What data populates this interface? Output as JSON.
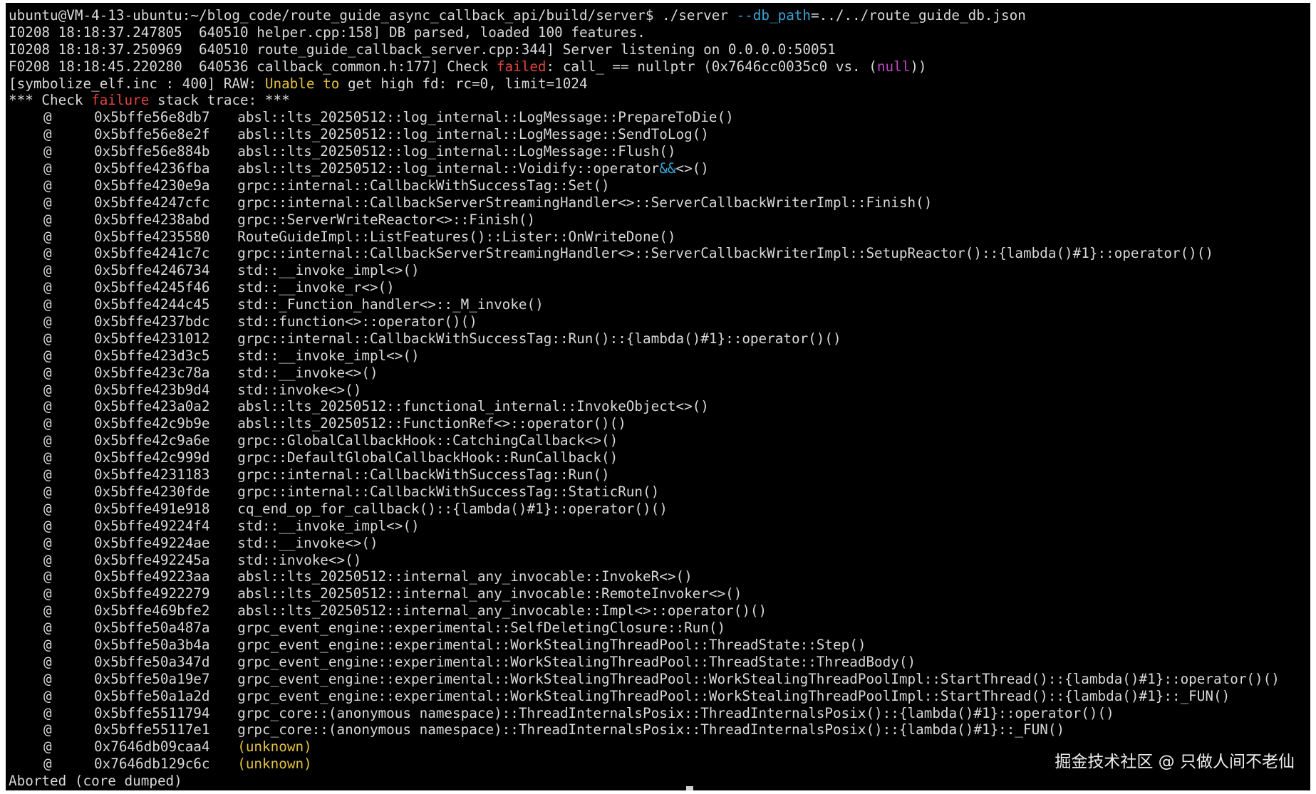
{
  "terminal": {
    "prompt": "ubuntu@VM-4-13-ubuntu:~/blog_code/route_guide_async_callback_api/build/server$ ",
    "command": "./server",
    "flag": "--db_path",
    "flag_value": "=../../route_guide_db.json",
    "log_lines": [
      "I0208 18:18:37.247805  640510 helper.cpp:158] DB parsed, loaded 100 features.",
      "I0208 18:18:37.250969  640510 route_guide_callback_server.cpp:344] Server listening on 0.0.0.0:50051"
    ],
    "fatal": {
      "prefix": "F0208 18:18:45.220280  640536 callback_common.h:177] Check ",
      "failed_word": "failed",
      "middle": ": call_ == nullptr (0x7646cc0035c0 vs. (",
      "null_word": "null",
      "suffix": "))"
    },
    "symbolize": {
      "prefix": "[symbolize_elf.inc : 400] RAW: ",
      "unable": "Unable to",
      "suffix": " get high fd: rc=0, limit=1024"
    },
    "trace_header": {
      "prefix": "*** Check ",
      "failure_word": "failure",
      "suffix": " stack trace: ***"
    },
    "frames": [
      {
        "at": "@",
        "addr": "0x5bffe56e8db7",
        "fn": "absl::lts_20250512::log_internal::LogMessage::PrepareToDie()"
      },
      {
        "at": "@",
        "addr": "0x5bffe56e8e2f",
        "fn": "absl::lts_20250512::log_internal::LogMessage::SendToLog()"
      },
      {
        "at": "@",
        "addr": "0x5bffe56e884b",
        "fn": "absl::lts_20250512::log_internal::LogMessage::Flush()"
      },
      {
        "at": "@",
        "addr": "0x5bffe4236fba",
        "fn": "absl::lts_20250512::log_internal::Voidify::operator",
        "hl": "&&",
        "fn2": "<>()"
      },
      {
        "at": "@",
        "addr": "0x5bffe4230e9a",
        "fn": "grpc::internal::CallbackWithSuccessTag::Set()"
      },
      {
        "at": "@",
        "addr": "0x5bffe4247cfc",
        "fn": "grpc::internal::CallbackServerStreamingHandler<>::ServerCallbackWriterImpl::Finish()"
      },
      {
        "at": "@",
        "addr": "0x5bffe4238abd",
        "fn": "grpc::ServerWriteReactor<>::Finish()"
      },
      {
        "at": "@",
        "addr": "0x5bffe4235580",
        "fn": "RouteGuideImpl::ListFeatures()::Lister::OnWriteDone()"
      },
      {
        "at": "@",
        "addr": "0x5bffe4241c7c",
        "fn": "grpc::internal::CallbackServerStreamingHandler<>::ServerCallbackWriterImpl::SetupReactor()::{lambda()#1}::operator()()"
      },
      {
        "at": "@",
        "addr": "0x5bffe4246734",
        "fn": "std::__invoke_impl<>()"
      },
      {
        "at": "@",
        "addr": "0x5bffe4245f46",
        "fn": "std::__invoke_r<>()"
      },
      {
        "at": "@",
        "addr": "0x5bffe4244c45",
        "fn": "std::_Function_handler<>::_M_invoke()"
      },
      {
        "at": "@",
        "addr": "0x5bffe4237bdc",
        "fn": "std::function<>::operator()()"
      },
      {
        "at": "@",
        "addr": "0x5bffe4231012",
        "fn": "grpc::internal::CallbackWithSuccessTag::Run()::{lambda()#1}::operator()()"
      },
      {
        "at": "@",
        "addr": "0x5bffe423d3c5",
        "fn": "std::__invoke_impl<>()"
      },
      {
        "at": "@",
        "addr": "0x5bffe423c78a",
        "fn": "std::__invoke<>()"
      },
      {
        "at": "@",
        "addr": "0x5bffe423b9d4",
        "fn": "std::invoke<>()"
      },
      {
        "at": "@",
        "addr": "0x5bffe423a0a2",
        "fn": "absl::lts_20250512::functional_internal::InvokeObject<>()"
      },
      {
        "at": "@",
        "addr": "0x5bffe42c9b9e",
        "fn": "absl::lts_20250512::FunctionRef<>::operator()()"
      },
      {
        "at": "@",
        "addr": "0x5bffe42c9a6e",
        "fn": "grpc::GlobalCallbackHook::CatchingCallback<>()"
      },
      {
        "at": "@",
        "addr": "0x5bffe42c999d",
        "fn": "grpc::DefaultGlobalCallbackHook::RunCallback()"
      },
      {
        "at": "@",
        "addr": "0x5bffe4231183",
        "fn": "grpc::internal::CallbackWithSuccessTag::Run()"
      },
      {
        "at": "@",
        "addr": "0x5bffe4230fde",
        "fn": "grpc::internal::CallbackWithSuccessTag::StaticRun()"
      },
      {
        "at": "@",
        "addr": "0x5bffe491e918",
        "fn": "cq_end_op_for_callback()::{lambda()#1}::operator()()"
      },
      {
        "at": "@",
        "addr": "0x5bffe49224f4",
        "fn": "std::__invoke_impl<>()"
      },
      {
        "at": "@",
        "addr": "0x5bffe49224ae",
        "fn": "std::__invoke<>()"
      },
      {
        "at": "@",
        "addr": "0x5bffe492245a",
        "fn": "std::invoke<>()"
      },
      {
        "at": "@",
        "addr": "0x5bffe49223aa",
        "fn": "absl::lts_20250512::internal_any_invocable::InvokeR<>()"
      },
      {
        "at": "@",
        "addr": "0x5bffe4922279",
        "fn": "absl::lts_20250512::internal_any_invocable::RemoteInvoker<>()"
      },
      {
        "at": "@",
        "addr": "0x5bffe469bfe2",
        "fn": "absl::lts_20250512::internal_any_invocable::Impl<>::operator()()"
      },
      {
        "at": "@",
        "addr": "0x5bffe50a487a",
        "fn": "grpc_event_engine::experimental::SelfDeletingClosure::Run()"
      },
      {
        "at": "@",
        "addr": "0x5bffe50a3b4a",
        "fn": "grpc_event_engine::experimental::WorkStealingThreadPool::ThreadState::Step()"
      },
      {
        "at": "@",
        "addr": "0x5bffe50a347d",
        "fn": "grpc_event_engine::experimental::WorkStealingThreadPool::ThreadState::ThreadBody()"
      },
      {
        "at": "@",
        "addr": "0x5bffe50a19e7",
        "fn": "grpc_event_engine::experimental::WorkStealingThreadPool::WorkStealingThreadPoolImpl::StartThread()::{lambda()#1}::operator()()"
      },
      {
        "at": "@",
        "addr": "0x5bffe50a1a2d",
        "fn": "grpc_event_engine::experimental::WorkStealingThreadPool::WorkStealingThreadPoolImpl::StartThread()::{lambda()#1}::_FUN()"
      },
      {
        "at": "@",
        "addr": "0x5bffe5511794",
        "fn": "grpc_core::(anonymous namespace)::ThreadInternalsPosix::ThreadInternalsPosix()::{lambda()#1}::operator()()"
      },
      {
        "at": "@",
        "addr": "0x5bffe55117e1",
        "fn": "grpc_core::(anonymous namespace)::ThreadInternalsPosix::ThreadInternalsPosix()::{lambda()#1}::_FUN()"
      },
      {
        "at": "@",
        "addr": "0x7646db09caa4",
        "fn": "",
        "unknown": "(unknown)"
      },
      {
        "at": "@",
        "addr": "0x7646db129c6c",
        "fn": "",
        "unknown": "(unknown)"
      }
    ],
    "final_line": "Aborted (core dumped)"
  },
  "watermark": "掘金技术社区 @ 只做人间不老仙",
  "colors": {
    "background": "#000000",
    "text": "#d8d8d8",
    "red": "#e0443e",
    "yellow": "#e3c23f",
    "cyan": "#3aa5d7",
    "magenta": "#c447c9"
  }
}
